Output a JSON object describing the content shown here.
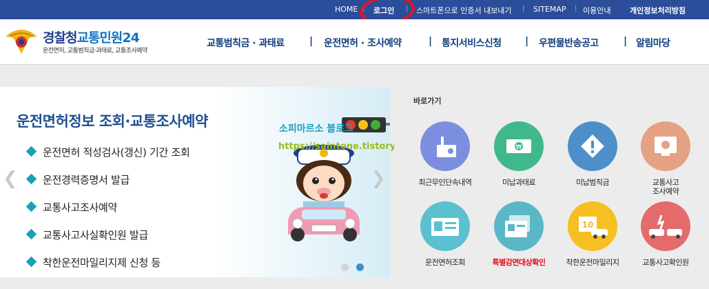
{
  "top_links": {
    "home": "HOME",
    "login": "로그인",
    "smartphone": "스마트폰으로 인증서 내보내기",
    "sitemap": "SITEMAP",
    "guide": "이용안내",
    "privacy": "개인정보처리방침"
  },
  "logo": {
    "title_a": "경찰청",
    "title_b": "교통민원24",
    "subtitle": "운전면허, 교통범칙금·과태료, 교통조사예약"
  },
  "gnb": [
    "교통범칙금 · 과태료",
    "운전면허 · 조사예약",
    "통지서비스신청",
    "우편물반송공고",
    "알림마당"
  ],
  "banner": {
    "title": "운전면허정보 조회·교통조사예약",
    "items": [
      "운전면허 적성검사(갱신) 기간 조회",
      "운전경력증명서 발급",
      "교통사고조사예약",
      "교통사고사실확인원 발급",
      "착한운전마일리지제 신청 등"
    ]
  },
  "watermark": {
    "line1": "소피마르소 블로그",
    "line2": "https://saintone.tistory.com"
  },
  "quick": {
    "title": "바로가기",
    "items": [
      {
        "label": "최근무인단속내역",
        "color": "#7b8ee0",
        "icon": "camera-icon"
      },
      {
        "label": "미납과태료",
        "color": "#3fb98b",
        "icon": "money-icon"
      },
      {
        "label": "미납범칙금",
        "color": "#4e8fc9",
        "icon": "warning-icon"
      },
      {
        "label": "교통사고\n조사예약",
        "color": "#e5a184",
        "icon": "monitor-icon"
      },
      {
        "label": "운전면허조회",
        "color": "#5bc0cf",
        "icon": "id-card-icon"
      },
      {
        "label": "특별감면대상확인",
        "color": "#5ab8c6",
        "icon": "documents-icon"
      },
      {
        "label": "착한운전마일리지",
        "color": "#f6bf22",
        "icon": "mileage-icon"
      },
      {
        "label": "교통사고확인원",
        "color": "#e36b6b",
        "icon": "car-crash-icon"
      }
    ]
  },
  "colors": {
    "topbar": "#2c4d99",
    "nav_text": "#123e7c",
    "highlight": "#e30f1b"
  }
}
